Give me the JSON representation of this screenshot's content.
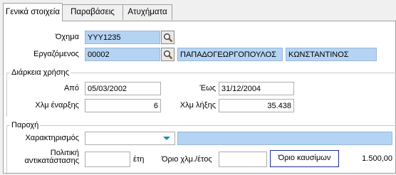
{
  "tabs": [
    {
      "label": "Γενικά στοιχεία"
    },
    {
      "label": "Παραβάσεις"
    },
    {
      "label": "Ατυχήματα"
    }
  ],
  "general": {
    "vehicle_label": "Όχημα",
    "vehicle_value": "YYY1235",
    "employee_label": "Εργαζόμενος",
    "employee_code": "00002",
    "employee_lastname": "ΠΑΠΑΔΟΓΕΩΡΓΟΠΟΥΛΟΣ",
    "employee_firstname": "ΚΩΝΣΤΑΝΤΙΝΟΣ"
  },
  "usage": {
    "title": "Διάρκεια χρήσης",
    "from_label": "Από",
    "from_value": "05/03/2002",
    "to_label": "Έως",
    "to_value": "31/12/2004",
    "km_start_label": "Χλμ έναρξης",
    "km_start_value": "6",
    "km_end_label": "Χλμ λήξης",
    "km_end_value": "35.438"
  },
  "provision": {
    "title": "Παροχή",
    "char_label": "Χαρακτηρισμός",
    "char_value": "",
    "char_desc": "",
    "policy_label_line1": "Πολιτική",
    "policy_label_line2": "αντικατάστασης",
    "policy_value": "",
    "years_label": "έτη",
    "km_limit_label": "Όριο χλμ./έτος",
    "km_limit_value": "",
    "fuel_limit_label": "Όριο καυσίμων",
    "fuel_limit_value": "1.500,00"
  },
  "colors": {
    "field_highlight": "#b5d3f3",
    "combo_arrow": "#1a8ab0",
    "focus_border": "#1c2d9a"
  }
}
